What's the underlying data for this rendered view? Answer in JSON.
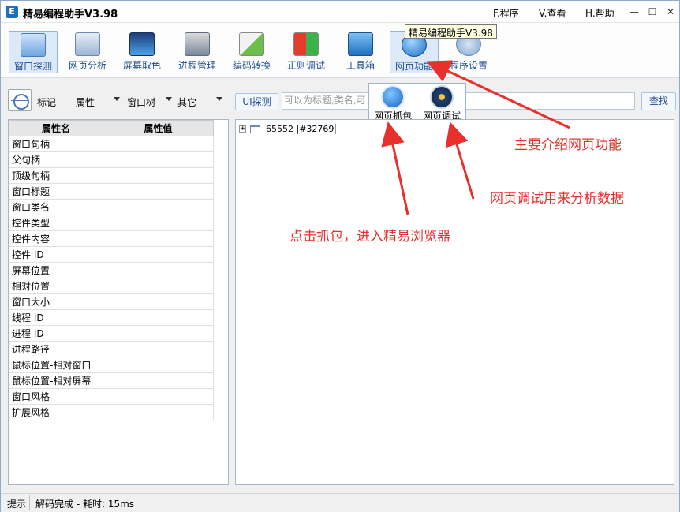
{
  "titlebar": {
    "title": "精易编程助手V3.98",
    "app_icon": "E",
    "menus": [
      "F.程序",
      "V.查看",
      "H.帮助"
    ],
    "window_buttons": {
      "minimize": "—",
      "maximize": "☐",
      "close": "✕"
    }
  },
  "toolbar": {
    "items": [
      {
        "label": "窗口探测",
        "icon": "window-probe-icon",
        "active": true
      },
      {
        "label": "网页分析",
        "icon": "web-analysis-icon"
      },
      {
        "label": "屏幕取色",
        "icon": "screen-color-icon"
      },
      {
        "label": "进程管理",
        "icon": "process-manager-icon"
      },
      {
        "label": "编码转换",
        "icon": "encoding-convert-icon"
      },
      {
        "label": "正则调试",
        "icon": "regex-debug-icon"
      },
      {
        "label": "工具箱",
        "icon": "toolbox-icon"
      },
      {
        "label": "网页功能",
        "icon": "web-function-icon",
        "hovered": true
      },
      {
        "label": "程序设置",
        "icon": "settings-icon"
      }
    ],
    "tooltip": "精易编程助手V3.98"
  },
  "search_row": {
    "mark_label": "标记",
    "property_label": "属性",
    "window_tree_label": "窗口树",
    "other_label": "其它",
    "ui_probe_label": "UI探测",
    "search_placeholder": "可以为标题,类名,可",
    "search_button": "查找"
  },
  "web_menu": {
    "items": [
      {
        "label": "网页抓包",
        "icon": "packet-capture-icon"
      },
      {
        "label": "网页调试",
        "icon": "web-debug-icon"
      }
    ]
  },
  "properties": {
    "headers": [
      "属性名",
      "属性值"
    ],
    "rows": [
      "窗口句柄",
      "父句柄",
      "顶级句柄",
      "窗口标题",
      "窗口类名",
      "控件类型",
      "控件内容",
      "控件 ID",
      "屏幕位置",
      "相对位置",
      "窗口大小",
      "线程 ID",
      "进程 ID",
      "进程路径",
      "鼠标位置-相对窗口",
      "鼠标位置-相对屏幕",
      "窗口风格",
      "扩展风格"
    ]
  },
  "tree": {
    "expander": "+",
    "node_label": "65552 |#32769"
  },
  "statusbar": {
    "label": "提示",
    "message": "解码完成 - 耗时: 15ms"
  },
  "annotations": {
    "main": "主要介绍网页功能",
    "debug": "网页调试用来分析数据",
    "capture": "点击抓包，进入精易浏览器",
    "color": "#e8302c"
  }
}
